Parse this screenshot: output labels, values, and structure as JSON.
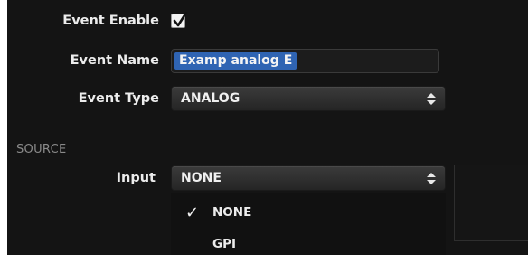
{
  "event": {
    "enable_label": "Event Enable",
    "enable_checked": true,
    "name_label": "Event Name",
    "name_value": "Examp analog E",
    "type_label": "Event Type",
    "type_value": "ANALOG"
  },
  "source": {
    "section_title": "SOURCE",
    "input_label": "Input",
    "input_value": "NONE",
    "options": [
      {
        "label": "NONE",
        "selected": true
      },
      {
        "label": "GPI",
        "selected": false
      }
    ]
  },
  "icons": {
    "checkbox_mark": "checkmark-icon",
    "select_arrows": "up-down-arrows-icon",
    "option_check": "checkmark-icon"
  },
  "colors": {
    "panel_bg": "#141414",
    "selection_highlight": "#2f64b3",
    "text": "#ececec",
    "section_title": "#8a8a8a"
  }
}
